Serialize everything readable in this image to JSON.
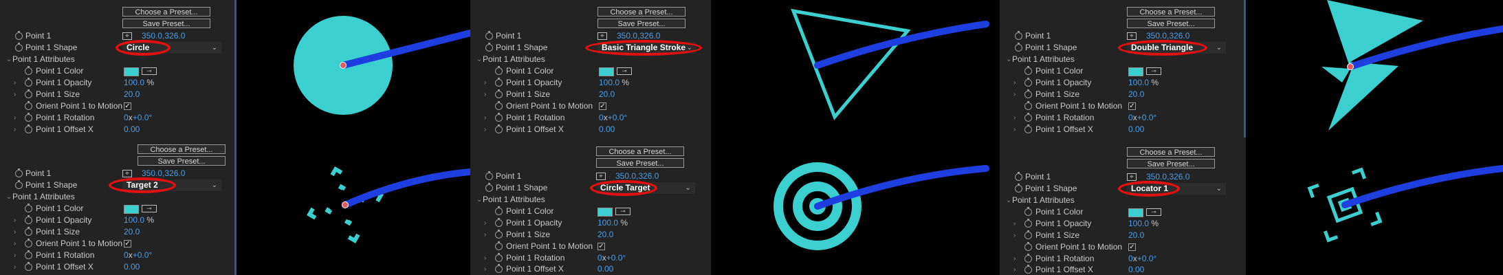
{
  "labels": {
    "choose_preset": "Choose a Preset...",
    "save_preset": "Save Preset...",
    "point": "Point 1",
    "shape": "Point 1 Shape",
    "attributes": "Point 1 Attributes",
    "color": "Point 1 Color",
    "opacity": "Point 1 Opacity",
    "size": "Point 1 Size",
    "orient": "Orient Point 1 to Motion",
    "rotation": "Point 1 Rotation",
    "offset_x": "Point 1 Offset X"
  },
  "values": {
    "point": "350.0,326.0",
    "opacity": "100.0",
    "opacity_unit": "%",
    "size": "20.0",
    "rotation": "0",
    "rotation_x": "x",
    "rotation_deg": "+0.0°",
    "offset_x": "0.00",
    "orient_checked": "✓"
  },
  "shapes": {
    "circle": "Circle",
    "basic_triangle_stroke": "Basic Triangle Stroke",
    "double_triangle": "Double Triangle",
    "target_2": "Target 2",
    "circle_target": "Circle Target",
    "locator_1": "Locator 1"
  },
  "colors": {
    "panel_bg": "#232323",
    "value_blue": "#4a9ee8",
    "highlight_red": "#e31010",
    "shape_cyan": "#3ccfd0",
    "path_blue": "#1e3ee0",
    "canvas_bg": "#000000"
  },
  "icons": [
    "stopwatch-icon",
    "crosshair-icon",
    "eyedropper-icon",
    "checkbox-icon",
    "twirl-arrow-icon",
    "chevron-down-icon"
  ]
}
